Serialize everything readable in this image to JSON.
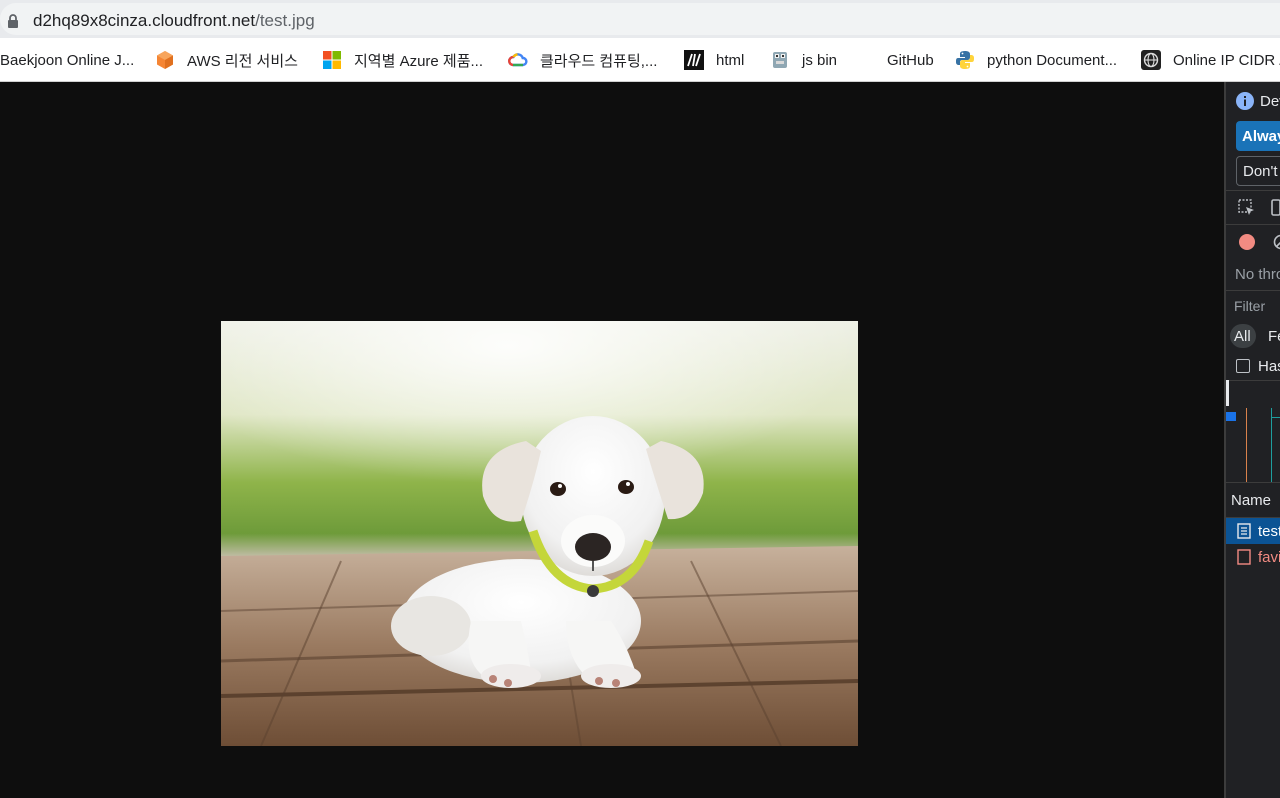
{
  "browser": {
    "url_host": "d2hq89x8cinza.cloudfront.net",
    "url_path": "/test.jpg"
  },
  "bookmarks": [
    {
      "label": "Baekjoon Online J...",
      "icon": "none"
    },
    {
      "label": "AWS 리전 서비스",
      "icon": "aws-cube-icon"
    },
    {
      "label": "지역별 Azure 제품...",
      "icon": "microsoft-logo-icon"
    },
    {
      "label": "클라우드 컴퓨팅,...",
      "icon": "google-cloud-icon"
    },
    {
      "label": "html",
      "icon": "mdn-icon"
    },
    {
      "label": "js bin",
      "icon": "jsbin-icon"
    },
    {
      "label": "GitHub",
      "icon": "none"
    },
    {
      "label": "python Document...",
      "icon": "python-icon"
    },
    {
      "label": "Online IP CIDR /",
      "icon": "globe-icon"
    }
  ],
  "devtools": {
    "info_text": "Dev",
    "always_button": "Alway",
    "dont_button": "Don't",
    "no_throttle": "No thro",
    "filter_placeholder": "Filter",
    "tab_all": "All",
    "tab_fetch": "Fe",
    "has_checkbox": "Has",
    "name_header": "Name",
    "rows": [
      {
        "label": "test",
        "type": "document",
        "color": "#ffffff"
      },
      {
        "label": "favi",
        "type": "error",
        "color": "#f28b82"
      }
    ]
  },
  "colors": {
    "selected_row": "#0b5394",
    "record_dot": "#f28b82",
    "always_button_bg": "#1a73b8"
  }
}
